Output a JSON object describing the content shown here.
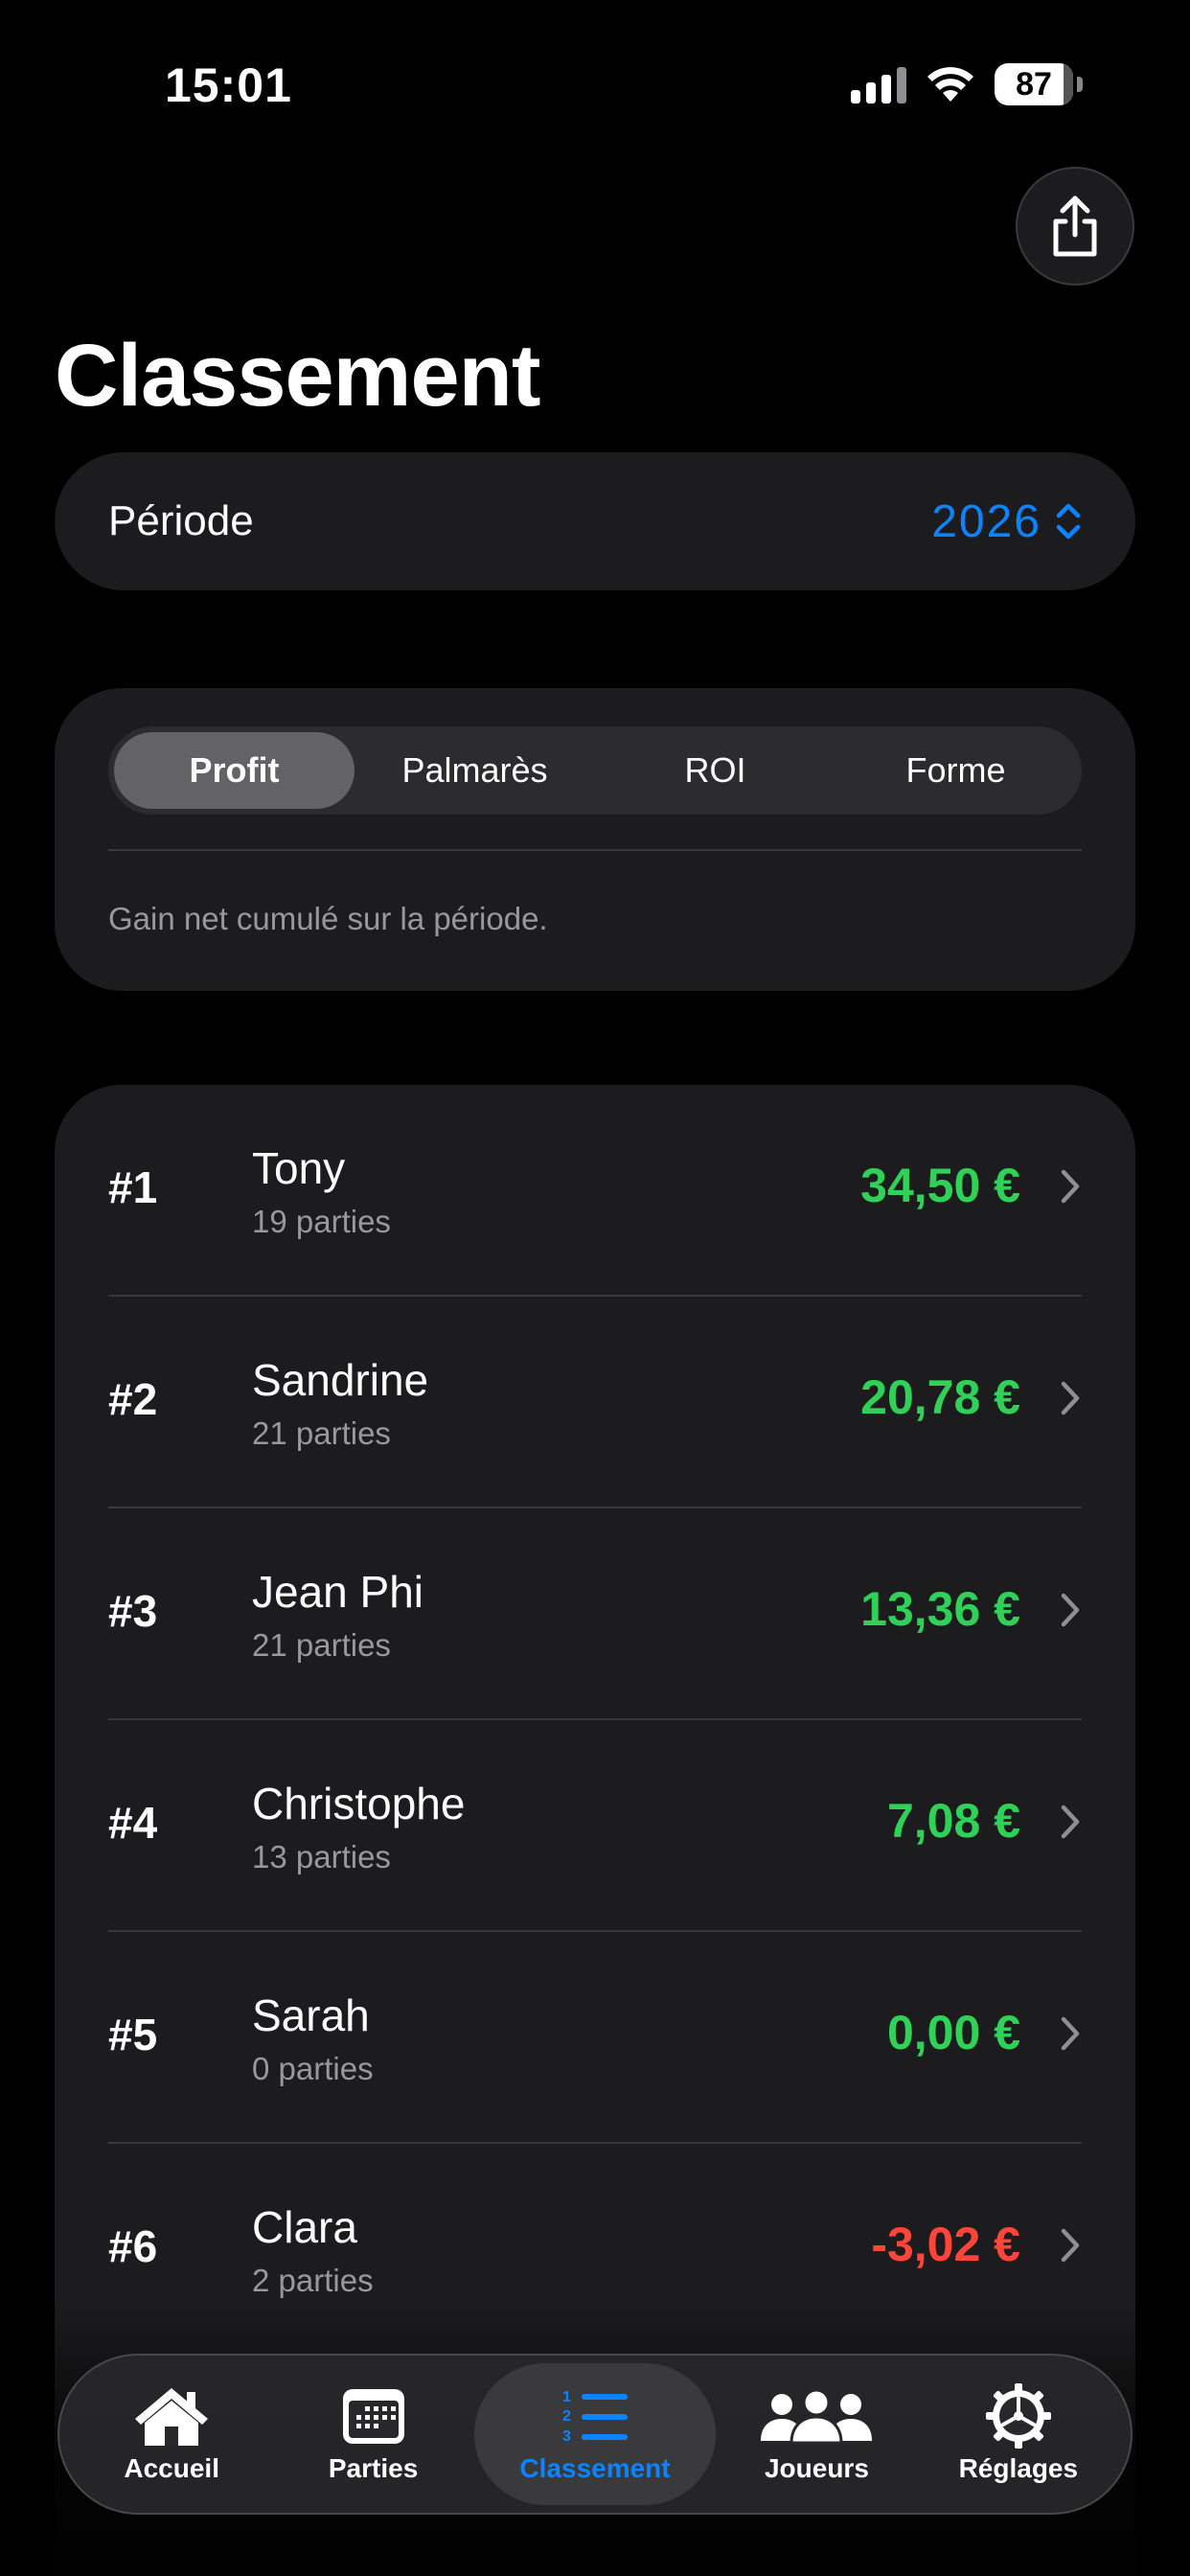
{
  "status": {
    "time": "15:01",
    "battery": "87"
  },
  "title": "Classement",
  "periode": {
    "label": "Période",
    "value": "2026"
  },
  "segments": {
    "items": [
      "Profit",
      "Palmarès",
      "ROI",
      "Forme"
    ],
    "active": "Profit",
    "description": "Gain net cumulé sur la période."
  },
  "ranking": [
    {
      "rank": "#1",
      "name": "Tony",
      "games": "19 parties",
      "amount": "34,50 €",
      "sign": "pos"
    },
    {
      "rank": "#2",
      "name": "Sandrine",
      "games": "21 parties",
      "amount": "20,78 €",
      "sign": "pos"
    },
    {
      "rank": "#3",
      "name": "Jean Phi",
      "games": "21 parties",
      "amount": "13,36 €",
      "sign": "pos"
    },
    {
      "rank": "#4",
      "name": "Christophe",
      "games": "13 parties",
      "amount": "7,08 €",
      "sign": "pos"
    },
    {
      "rank": "#5",
      "name": "Sarah",
      "games": "0 parties",
      "amount": "0,00 €",
      "sign": "pos"
    },
    {
      "rank": "#6",
      "name": "Clara",
      "games": "2 parties",
      "amount": "-3,02 €",
      "sign": "neg"
    }
  ],
  "tabbar": {
    "home": "Accueil",
    "games": "Parties",
    "ranking": "Classement",
    "players": "Joueurs",
    "settings": "Réglages"
  },
  "colors": {
    "accent": "#0a84ff",
    "positive": "#30d158",
    "negative": "#ff453a"
  }
}
